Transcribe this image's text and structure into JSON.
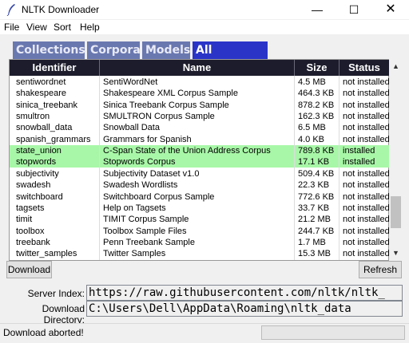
{
  "window": {
    "title": "NLTK Downloader",
    "controls": {
      "minimize": "—",
      "maximize": "☐",
      "close": "✕"
    }
  },
  "menu": [
    "File",
    "View",
    "Sort",
    "Help"
  ],
  "tabs": [
    {
      "label": "Collections",
      "active": false
    },
    {
      "label": "Corpora",
      "active": false
    },
    {
      "label": "Models",
      "active": false
    },
    {
      "label": "All Packages",
      "active": true
    }
  ],
  "table": {
    "columns": [
      "Identifier",
      "Name",
      "Size",
      "Status"
    ],
    "rows": [
      {
        "id": "sentiwordnet",
        "name": "SentiWordNet",
        "size": "4.5 MB",
        "status": "not installed"
      },
      {
        "id": "shakespeare",
        "name": "Shakespeare XML Corpus Sample",
        "size": "464.3 KB",
        "status": "not installed"
      },
      {
        "id": "sinica_treebank",
        "name": "Sinica Treebank Corpus Sample",
        "size": "878.2 KB",
        "status": "not installed"
      },
      {
        "id": "smultron",
        "name": "SMULTRON Corpus Sample",
        "size": "162.3 KB",
        "status": "not installed"
      },
      {
        "id": "snowball_data",
        "name": "Snowball Data",
        "size": "6.5 MB",
        "status": "not installed"
      },
      {
        "id": "spanish_grammars",
        "name": "Grammars for Spanish",
        "size": "4.0 KB",
        "status": "not installed"
      },
      {
        "id": "state_union",
        "name": "C-Span State of the Union Address Corpus",
        "size": "789.8 KB",
        "status": "installed"
      },
      {
        "id": "stopwords",
        "name": "Stopwords Corpus",
        "size": "17.1 KB",
        "status": "installed"
      },
      {
        "id": "subjectivity",
        "name": "Subjectivity Dataset v1.0",
        "size": "509.4 KB",
        "status": "not installed"
      },
      {
        "id": "swadesh",
        "name": "Swadesh Wordlists",
        "size": "22.3 KB",
        "status": "not installed"
      },
      {
        "id": "switchboard",
        "name": "Switchboard Corpus Sample",
        "size": "772.6 KB",
        "status": "not installed"
      },
      {
        "id": "tagsets",
        "name": "Help on Tagsets",
        "size": "33.7 KB",
        "status": "not installed"
      },
      {
        "id": "timit",
        "name": "TIMIT Corpus Sample",
        "size": "21.2 MB",
        "status": "not installed"
      },
      {
        "id": "toolbox",
        "name": "Toolbox Sample Files",
        "size": "244.7 KB",
        "status": "not installed"
      },
      {
        "id": "treebank",
        "name": "Penn Treebank Sample",
        "size": "1.7 MB",
        "status": "not installed"
      },
      {
        "id": "twitter_samples",
        "name": "Twitter Samples",
        "size": "15.3 MB",
        "status": "not installed"
      }
    ],
    "installed_color": "#a8f7a8",
    "header_color": "#1c1c2c"
  },
  "buttons": {
    "download": "Download",
    "refresh": "Refresh"
  },
  "server_index": {
    "label": "Server Index:",
    "value": "https://raw.githubusercontent.com/nltk/nltk_"
  },
  "download_dir": {
    "label": "Download Directory:",
    "value": "C:\\Users\\Dell\\AppData\\Roaming\\nltk_data"
  },
  "status_bar": {
    "message": "Download aborted!"
  },
  "scrollbar": {
    "up": "▲",
    "down": "▼"
  },
  "colors": {
    "tab_active": "#2a35c8",
    "tab_inactive": "#6a78b0"
  }
}
